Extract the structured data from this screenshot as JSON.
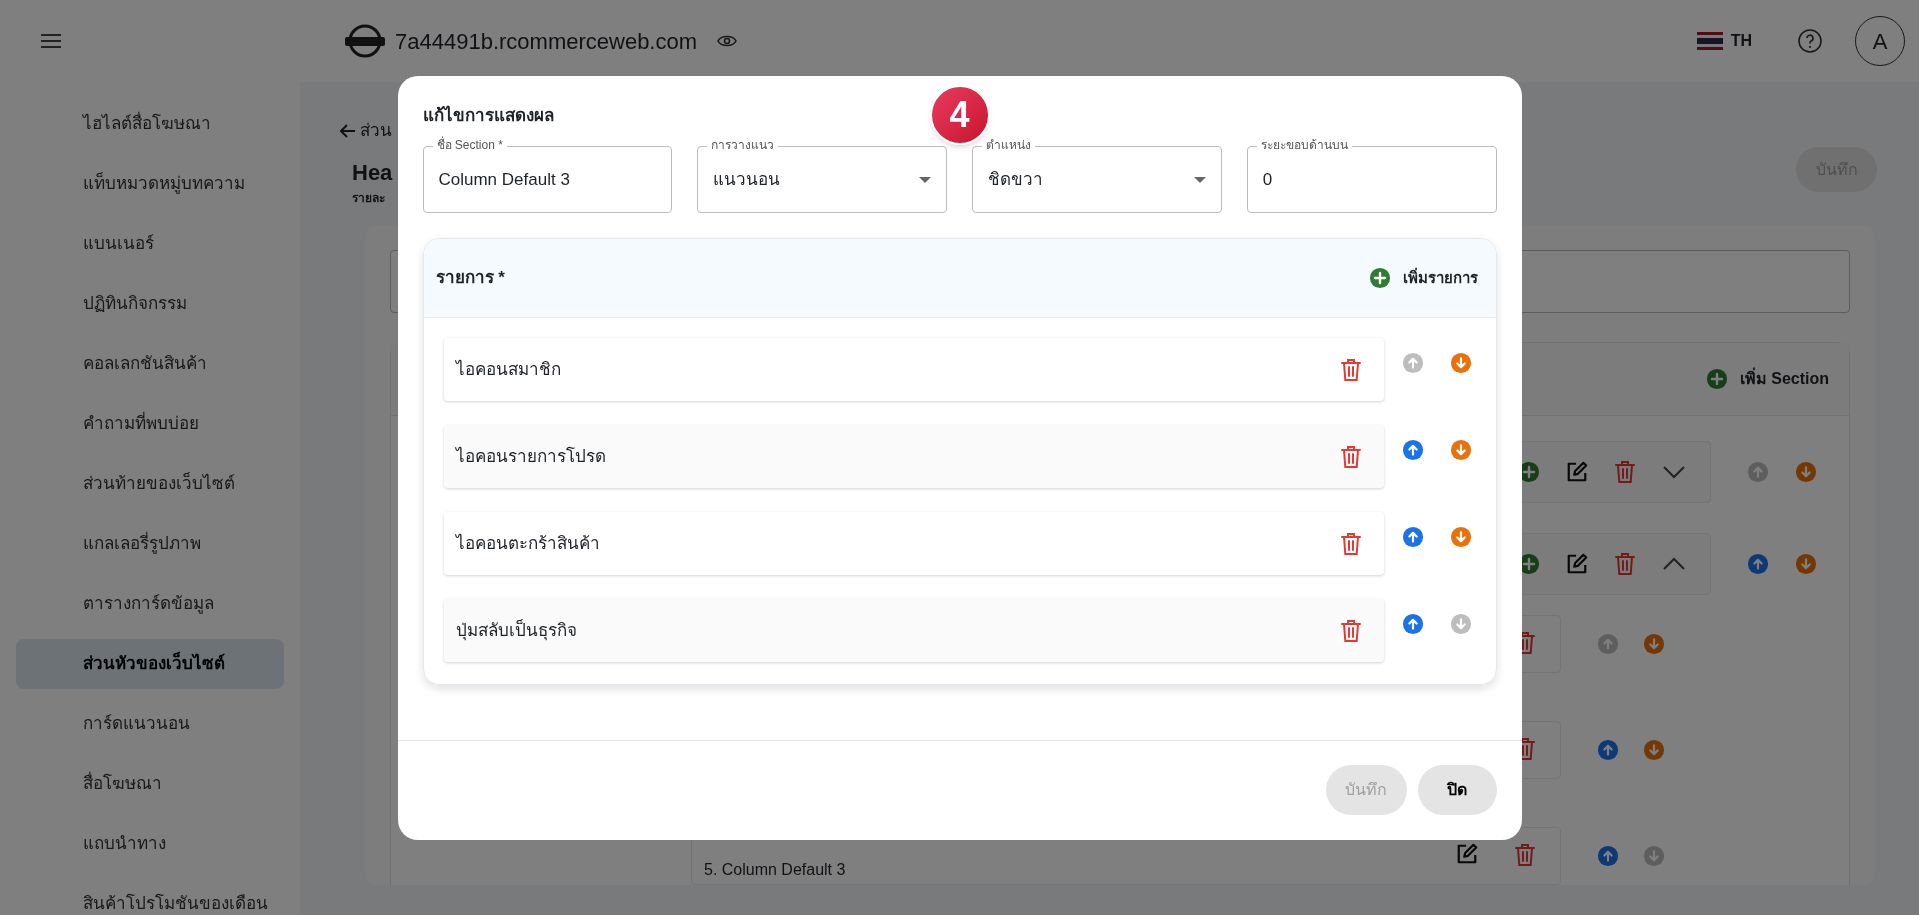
{
  "header": {
    "domain": "7a44491b.rcommerceweb.com",
    "language": "TH",
    "avatar": "A"
  },
  "sidebar": {
    "items": [
      {
        "label": "ไฮไลต์สื่อโฆษณา",
        "selected": false
      },
      {
        "label": "แท็บหมวดหมู่บทความ",
        "selected": false
      },
      {
        "label": "แบนเนอร์",
        "selected": false
      },
      {
        "label": "ปฏิทินกิจกรรม",
        "selected": false
      },
      {
        "label": "คอลเลกชันสินค้า",
        "selected": false
      },
      {
        "label": "คำถามที่พบบ่อย",
        "selected": false
      },
      {
        "label": "ส่วนท้ายของเว็บไซต์",
        "selected": false
      },
      {
        "label": "แกลเลอรี่รูปภาพ",
        "selected": false
      },
      {
        "label": "ตารางการ์ดข้อมูล",
        "selected": false
      },
      {
        "label": "ส่วนหัวของเว็บไซต์",
        "selected": true
      },
      {
        "label": "การ์ดแนวนอน",
        "selected": false
      },
      {
        "label": "สื่อโฆษณา",
        "selected": false
      },
      {
        "label": "แถบนำทาง",
        "selected": false
      },
      {
        "label": "สินค้าโปรโมชันของเดือน",
        "selected": false
      }
    ]
  },
  "page": {
    "back_label": "ส่วน",
    "title": "Hea",
    "subtitle": "รายละ",
    "save_button": {
      "label": "บันทึก",
      "disabled": true
    },
    "sections": {
      "add_label": "เพิ่ม Section",
      "rows": [
        {
          "expanded": false,
          "up_enabled": false,
          "down_enabled": true
        },
        {
          "expanded": true,
          "up_enabled": true,
          "down_enabled": true,
          "children": [
            {
              "up_enabled": false,
              "down_enabled": true
            },
            {
              "up_enabled": true,
              "down_enabled": true
            },
            {
              "label": "5. Column Default 3",
              "up_enabled": true,
              "down_enabled": false
            }
          ]
        }
      ]
    }
  },
  "dialog": {
    "title": "แก้ไขการแสดงผล",
    "step_badge": "4",
    "fields": [
      {
        "kind": "text",
        "label": "ชื่อ Section *",
        "value": "Column Default 3"
      },
      {
        "kind": "select",
        "label": "การวางแนว",
        "value": "แนวนอน"
      },
      {
        "kind": "select",
        "label": "ตำแหน่ง",
        "value": "ชิดขวา"
      },
      {
        "kind": "text",
        "label": "ระยะขอบด้านบน",
        "value": "0"
      }
    ],
    "list": {
      "title": "รายการ *",
      "add_label": "เพิ่มรายการ",
      "items": [
        {
          "label": "ไอคอนสมาชิก",
          "up_enabled": false,
          "down_enabled": true
        },
        {
          "label": "ไอคอนรายการโปรด",
          "up_enabled": true,
          "down_enabled": true
        },
        {
          "label": "ไอคอนตะกร้าสินค้า",
          "up_enabled": true,
          "down_enabled": true
        },
        {
          "label": "ปุ่มสลับเป็นธุรกิจ",
          "up_enabled": true,
          "down_enabled": false
        }
      ]
    },
    "buttons": [
      {
        "kind": "save",
        "label": "บันทึก",
        "disabled": true
      },
      {
        "kind": "close",
        "label": "ปิด",
        "disabled": false
      }
    ]
  }
}
